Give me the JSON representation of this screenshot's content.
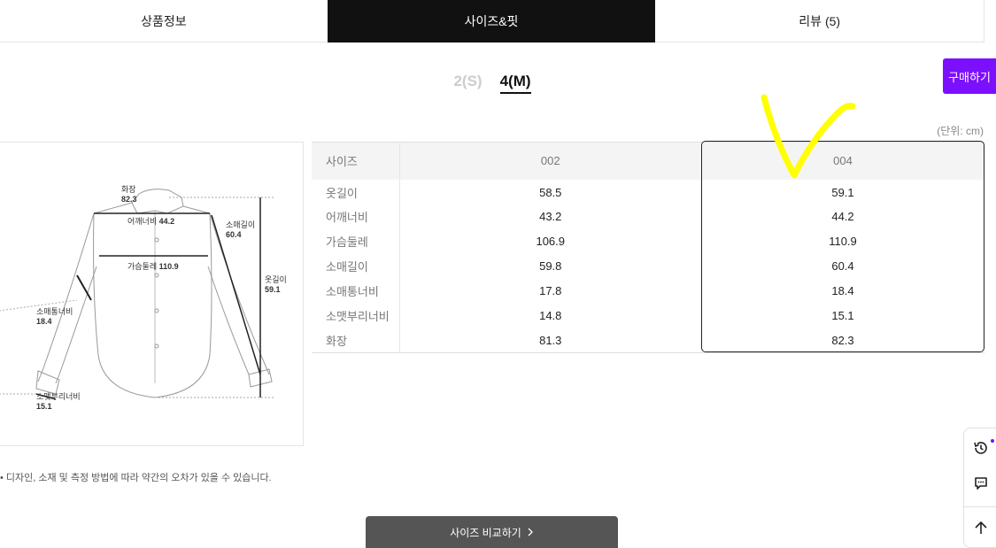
{
  "tabs": [
    {
      "label": "상품정보"
    },
    {
      "label": "사이즈&핏"
    },
    {
      "label": "리뷰 (5)"
    }
  ],
  "buy_button": "구매하기",
  "size_options": [
    {
      "label": "2(S)"
    },
    {
      "label": "4(M)"
    }
  ],
  "unit_label": "(단위: cm)",
  "illustration": {
    "labels": {
      "hwajang": {
        "name": "화장",
        "value": "82.3"
      },
      "shoulder": {
        "name": "어깨너비",
        "value": "44.2"
      },
      "sleeve_length": {
        "name": "소매길이",
        "value": "60.4"
      },
      "chest": {
        "name": "가슴둘레",
        "value": "110.9"
      },
      "total_length": {
        "name": "옷길이",
        "value": "59.1"
      },
      "sleeve_width": {
        "name": "소매통너비",
        "value": "18.4"
      },
      "cuff": {
        "name": "소맷부리너비",
        "value": "15.1"
      }
    }
  },
  "table": {
    "headers": [
      "사이즈",
      "002",
      "004"
    ],
    "rows": [
      {
        "label": "옷길이",
        "v002": "58.5",
        "v004": "59.1"
      },
      {
        "label": "어깨너비",
        "v002": "43.2",
        "v004": "44.2"
      },
      {
        "label": "가슴둘레",
        "v002": "106.9",
        "v004": "110.9"
      },
      {
        "label": "소매길이",
        "v002": "59.8",
        "v004": "60.4"
      },
      {
        "label": "소매통너비",
        "v002": "17.8",
        "v004": "18.4"
      },
      {
        "label": "소맷부리너비",
        "v002": "14.8",
        "v004": "15.1"
      },
      {
        "label": "화장",
        "v002": "81.3",
        "v004": "82.3"
      }
    ]
  },
  "note": "• 디자인, 소재 및 측정 방법에 따라 약간의 오차가 있을 수 있습니다.",
  "compare_button": "사이즈 비교하기",
  "colors": {
    "accent": "#7d0fff",
    "active_tab": "#111111",
    "annotation": "#ffff00"
  },
  "icons": {
    "recent": "recent-history-icon",
    "chat": "chat-icon",
    "top": "arrow-up-icon",
    "chevron": "chevron-right-icon"
  }
}
